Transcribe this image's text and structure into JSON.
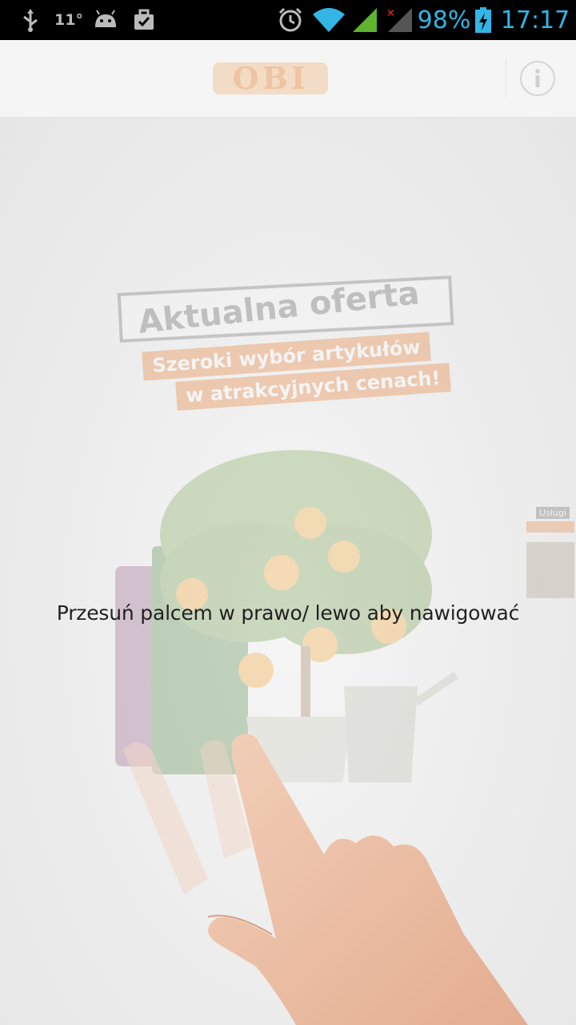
{
  "status_bar": {
    "temperature": "11°",
    "battery_percent": "98%",
    "time": "17:17",
    "icons": [
      "usb-icon",
      "android-icon",
      "briefcase-check-icon",
      "alarm-icon",
      "wifi-icon",
      "signal-icon",
      "signal-no-service-icon",
      "battery-charging-icon"
    ]
  },
  "app_bar": {
    "logo_text": "OBI",
    "info_icon": "info-icon"
  },
  "promo": {
    "title": "Aktualna oferta",
    "line1": "Szeroki wybór artykułów",
    "line2": "w atrakcyjnych cenach!"
  },
  "side_peek": {
    "label": "Usługi"
  },
  "overlay": {
    "instruction": "Przesuń palcem w prawo/ lewo aby nawigować"
  },
  "colors": {
    "accent": "#33b5e5",
    "brand_orange": "#e8823a",
    "status_bar_bg": "#000000"
  }
}
